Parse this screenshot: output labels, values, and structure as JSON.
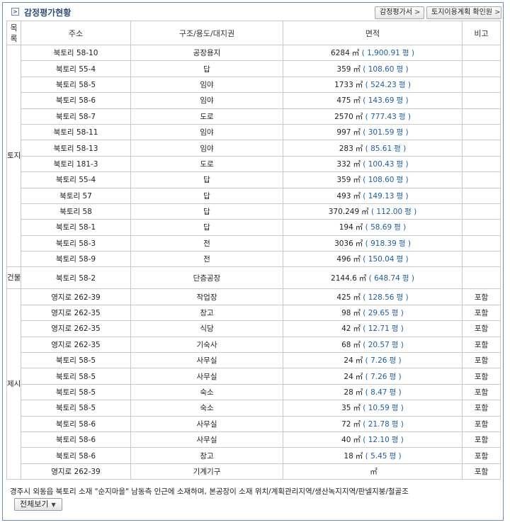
{
  "header": {
    "title": "감정평가현황",
    "buttons": [
      {
        "label": "감정평가서"
      },
      {
        "label": "토지이용계획 확인원"
      }
    ]
  },
  "table": {
    "headers": [
      "목록",
      "주소",
      "구조/용도/대지권",
      "면적",
      "비고"
    ],
    "area_unit": "㎡",
    "pyeong_unit": "평",
    "groups": [
      {
        "category": "토지",
        "rows": [
          {
            "address": "북토리 58-10",
            "use": "공장용지",
            "area": "6284",
            "pyeong": "1,900.91",
            "note": ""
          },
          {
            "address": "북토리 55-4",
            "use": "답",
            "area": "359",
            "pyeong": "108.60",
            "note": ""
          },
          {
            "address": "북토리 58-5",
            "use": "임야",
            "area": "1733",
            "pyeong": "524.23",
            "note": ""
          },
          {
            "address": "북토리 58-6",
            "use": "임야",
            "area": "475",
            "pyeong": "143.69",
            "note": ""
          },
          {
            "address": "북토리 58-7",
            "use": "도로",
            "area": "2570",
            "pyeong": "777.43",
            "note": ""
          },
          {
            "address": "북토리 58-11",
            "use": "임야",
            "area": "997",
            "pyeong": "301.59",
            "note": ""
          },
          {
            "address": "북토리 58-13",
            "use": "임야",
            "area": "283",
            "pyeong": "85.61",
            "note": ""
          },
          {
            "address": "북토리 181-3",
            "use": "도로",
            "area": "332",
            "pyeong": "100.43",
            "note": ""
          },
          {
            "address": "북토리 55-4",
            "use": "답",
            "area": "359",
            "pyeong": "108.60",
            "note": ""
          },
          {
            "address": "북토리 57",
            "use": "답",
            "area": "493",
            "pyeong": "149.13",
            "note": ""
          },
          {
            "address": "북토리 58",
            "use": "답",
            "area": "370.249",
            "pyeong": "112.00",
            "note": ""
          },
          {
            "address": "북토리 58-1",
            "use": "답",
            "area": "194",
            "pyeong": "58.69",
            "note": ""
          },
          {
            "address": "북토리 58-3",
            "use": "전",
            "area": "3036",
            "pyeong": "918.39",
            "note": ""
          },
          {
            "address": "북토리 58-9",
            "use": "전",
            "area": "496",
            "pyeong": "150.04",
            "note": ""
          }
        ]
      },
      {
        "category": "건물",
        "rows": [
          {
            "address": "북토리 58-2",
            "use": "단층공장",
            "area": "2144.6",
            "pyeong": "648.74",
            "note": ""
          }
        ]
      },
      {
        "category": "제시외건물",
        "rows": [
          {
            "address": "영지로 262-39",
            "use": "작업장",
            "area": "425",
            "pyeong": "128.56",
            "note": "포함"
          },
          {
            "address": "영지로 262-35",
            "use": "창고",
            "area": "98",
            "pyeong": "29.65",
            "note": "포함"
          },
          {
            "address": "영지로 262-35",
            "use": "식당",
            "area": "42",
            "pyeong": "12.71",
            "note": "포함"
          },
          {
            "address": "영지로 262-35",
            "use": "기숙사",
            "area": "68",
            "pyeong": "20.57",
            "note": "포함"
          },
          {
            "address": "북토리 58-5",
            "use": "사무실",
            "area": "24",
            "pyeong": "7.26",
            "note": "포함"
          },
          {
            "address": "북토리 58-5",
            "use": "사무실",
            "area": "24",
            "pyeong": "7.26",
            "note": "포함"
          },
          {
            "address": "북토리 58-5",
            "use": "숙소",
            "area": "28",
            "pyeong": "8.47",
            "note": "포함"
          },
          {
            "address": "북토리 58-5",
            "use": "숙소",
            "area": "35",
            "pyeong": "10.59",
            "note": "포함"
          },
          {
            "address": "북토리 58-6",
            "use": "사무실",
            "area": "72",
            "pyeong": "21.78",
            "note": "포함"
          },
          {
            "address": "북토리 58-6",
            "use": "사무실",
            "area": "40",
            "pyeong": "12.10",
            "note": "포함"
          },
          {
            "address": "북토리 58-6",
            "use": "창고",
            "area": "18",
            "pyeong": "5.45",
            "note": "포함"
          },
          {
            "address": "영지로 262-39",
            "use": "기계기구",
            "area": "",
            "pyeong": "",
            "note": "포함"
          }
        ]
      }
    ]
  },
  "description": "경주시 외동읍 북토리 소재 \"순지마을\" 남동측 인근에 소재하며, 본공장이 소재 위치/계획관리지역/생산녹지지역/판넬지붕/철골조",
  "view_all_label": "전체보기",
  "colors": {
    "border": "#6f8fb8",
    "title": "#2c4f7d",
    "pyeong": "#1c5fa8"
  }
}
